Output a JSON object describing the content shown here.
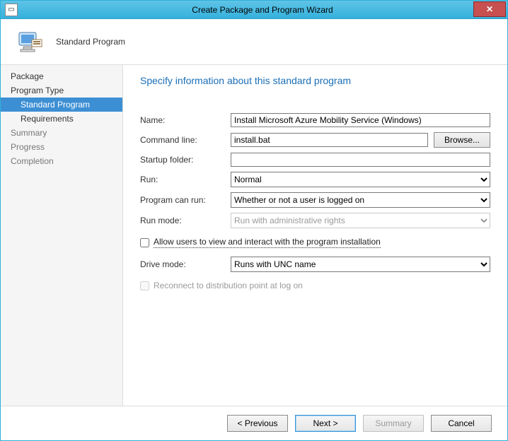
{
  "window": {
    "title": "Create Package and Program Wizard"
  },
  "header": {
    "title": "Standard Program"
  },
  "sidebar": {
    "items": [
      {
        "label": "Package"
      },
      {
        "label": "Program Type"
      },
      {
        "label": "Standard Program"
      },
      {
        "label": "Requirements"
      },
      {
        "label": "Summary"
      },
      {
        "label": "Progress"
      },
      {
        "label": "Completion"
      }
    ]
  },
  "main": {
    "heading": "Specify information about this standard program",
    "labels": {
      "name": "Name:",
      "cmd": "Command line:",
      "startup": "Startup folder:",
      "run": "Run:",
      "canrun": "Program can run:",
      "runmode": "Run mode:",
      "allow": "Allow users to view and interact with the program installation",
      "drive": "Drive mode:",
      "reconnect": "Reconnect to distribution point at log on"
    },
    "values": {
      "name": "Install Microsoft Azure Mobility Service (Windows)",
      "cmd": "install.bat",
      "startup": "",
      "run": "Normal",
      "canrun": "Whether or not a user is logged on",
      "runmode": "Run with administrative rights",
      "drive": "Runs with UNC name"
    },
    "browse": "Browse..."
  },
  "actions": {
    "previous": "< Previous",
    "next": "Next >",
    "summary": "Summary",
    "cancel": "Cancel"
  }
}
